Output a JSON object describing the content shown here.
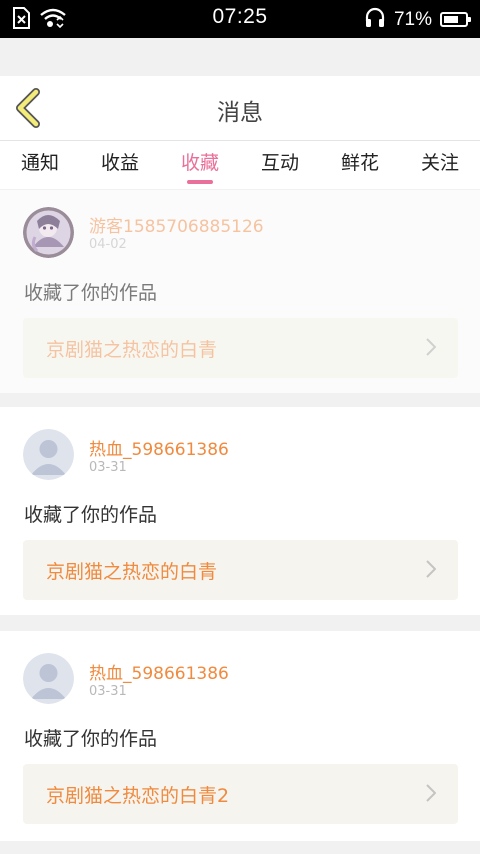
{
  "status_bar": {
    "time": "07:25",
    "battery_percent_text": "71%",
    "battery_level": 0.71,
    "icons": [
      "sim-card-icon",
      "wifi-icon",
      "headphones-icon",
      "battery-icon"
    ]
  },
  "header": {
    "title": "消息",
    "back_icon": "chevron-left-icon"
  },
  "tabs": [
    {
      "label": "通知",
      "active": false
    },
    {
      "label": "收益",
      "active": false
    },
    {
      "label": "收藏",
      "active": true
    },
    {
      "label": "互动",
      "active": false
    },
    {
      "label": "鲜花",
      "active": false
    },
    {
      "label": "关注",
      "active": false
    }
  ],
  "messages": [
    {
      "username": "游客1585706885126",
      "date": "04-02",
      "action": "收藏了你的作品",
      "work_title": "京剧猫之热恋的白青",
      "avatar": "custom-avatar-icon"
    },
    {
      "username": "热血_598661386",
      "date": "03-31",
      "action": "收藏了你的作品",
      "work_title": "京剧猫之热恋的白青",
      "avatar": "default-avatar-icon"
    },
    {
      "username": "热血_598661386",
      "date": "03-31",
      "action": "收藏了你的作品",
      "work_title": "京剧猫之热恋的白青2",
      "avatar": "default-avatar-icon"
    }
  ],
  "colors": {
    "accent": "#e8709a",
    "username": "#f08a3e",
    "work_box": "#f5f4ee",
    "status_bar": "#000000"
  }
}
